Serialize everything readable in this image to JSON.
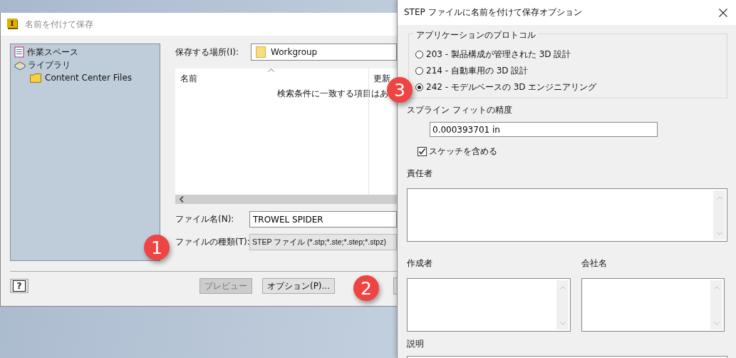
{
  "save_dialog": {
    "title": "名前を付けて保存",
    "places": [
      {
        "label": "作業スペース",
        "kind": "workspace"
      },
      {
        "label": "ライブラリ",
        "kind": "library",
        "children": [
          {
            "label": "Content Center Files",
            "kind": "folder"
          }
        ]
      }
    ],
    "save_in": {
      "label": "保存する場所(I):",
      "value": "Workgroup"
    },
    "file_list": {
      "columns": [
        "名前",
        "更新"
      ],
      "empty_message": "検索条件に一致する項目はあ"
    },
    "file_name": {
      "label": "ファイル名(N):",
      "value": "TROWEL SPIDER"
    },
    "file_type": {
      "label": "ファイルの種類(T):",
      "value": "STEP ファイル (*.stp;*.ste;*.step;*.stpz)"
    },
    "help": "?",
    "buttons": [
      {
        "label": "プレビュー",
        "disabled": true
      },
      {
        "label": "オプション(P)...",
        "disabled": false
      }
    ]
  },
  "options_dialog": {
    "title": "STEP ファイルに名前を付けて保存オプション",
    "protocol": {
      "legend": "アプリケーションのプロトコル",
      "options": [
        {
          "label": "203 - 製品構成が管理された 3D 設計",
          "selected": false
        },
        {
          "label": "214 - 自動車用の 3D 設計",
          "selected": false
        },
        {
          "label": "242 - モデルベースの 3D エンジニアリング",
          "selected": true
        }
      ]
    },
    "spline": {
      "label": "スプライン フィットの精度",
      "value": "0.000393701 in"
    },
    "include_sketch": {
      "label": "スケッチを含める",
      "checked": true
    },
    "fields": {
      "responsible": "責任者",
      "author": "作成者",
      "company": "会社名",
      "description": "説明"
    }
  },
  "annotations": [
    "1",
    "2",
    "3"
  ]
}
